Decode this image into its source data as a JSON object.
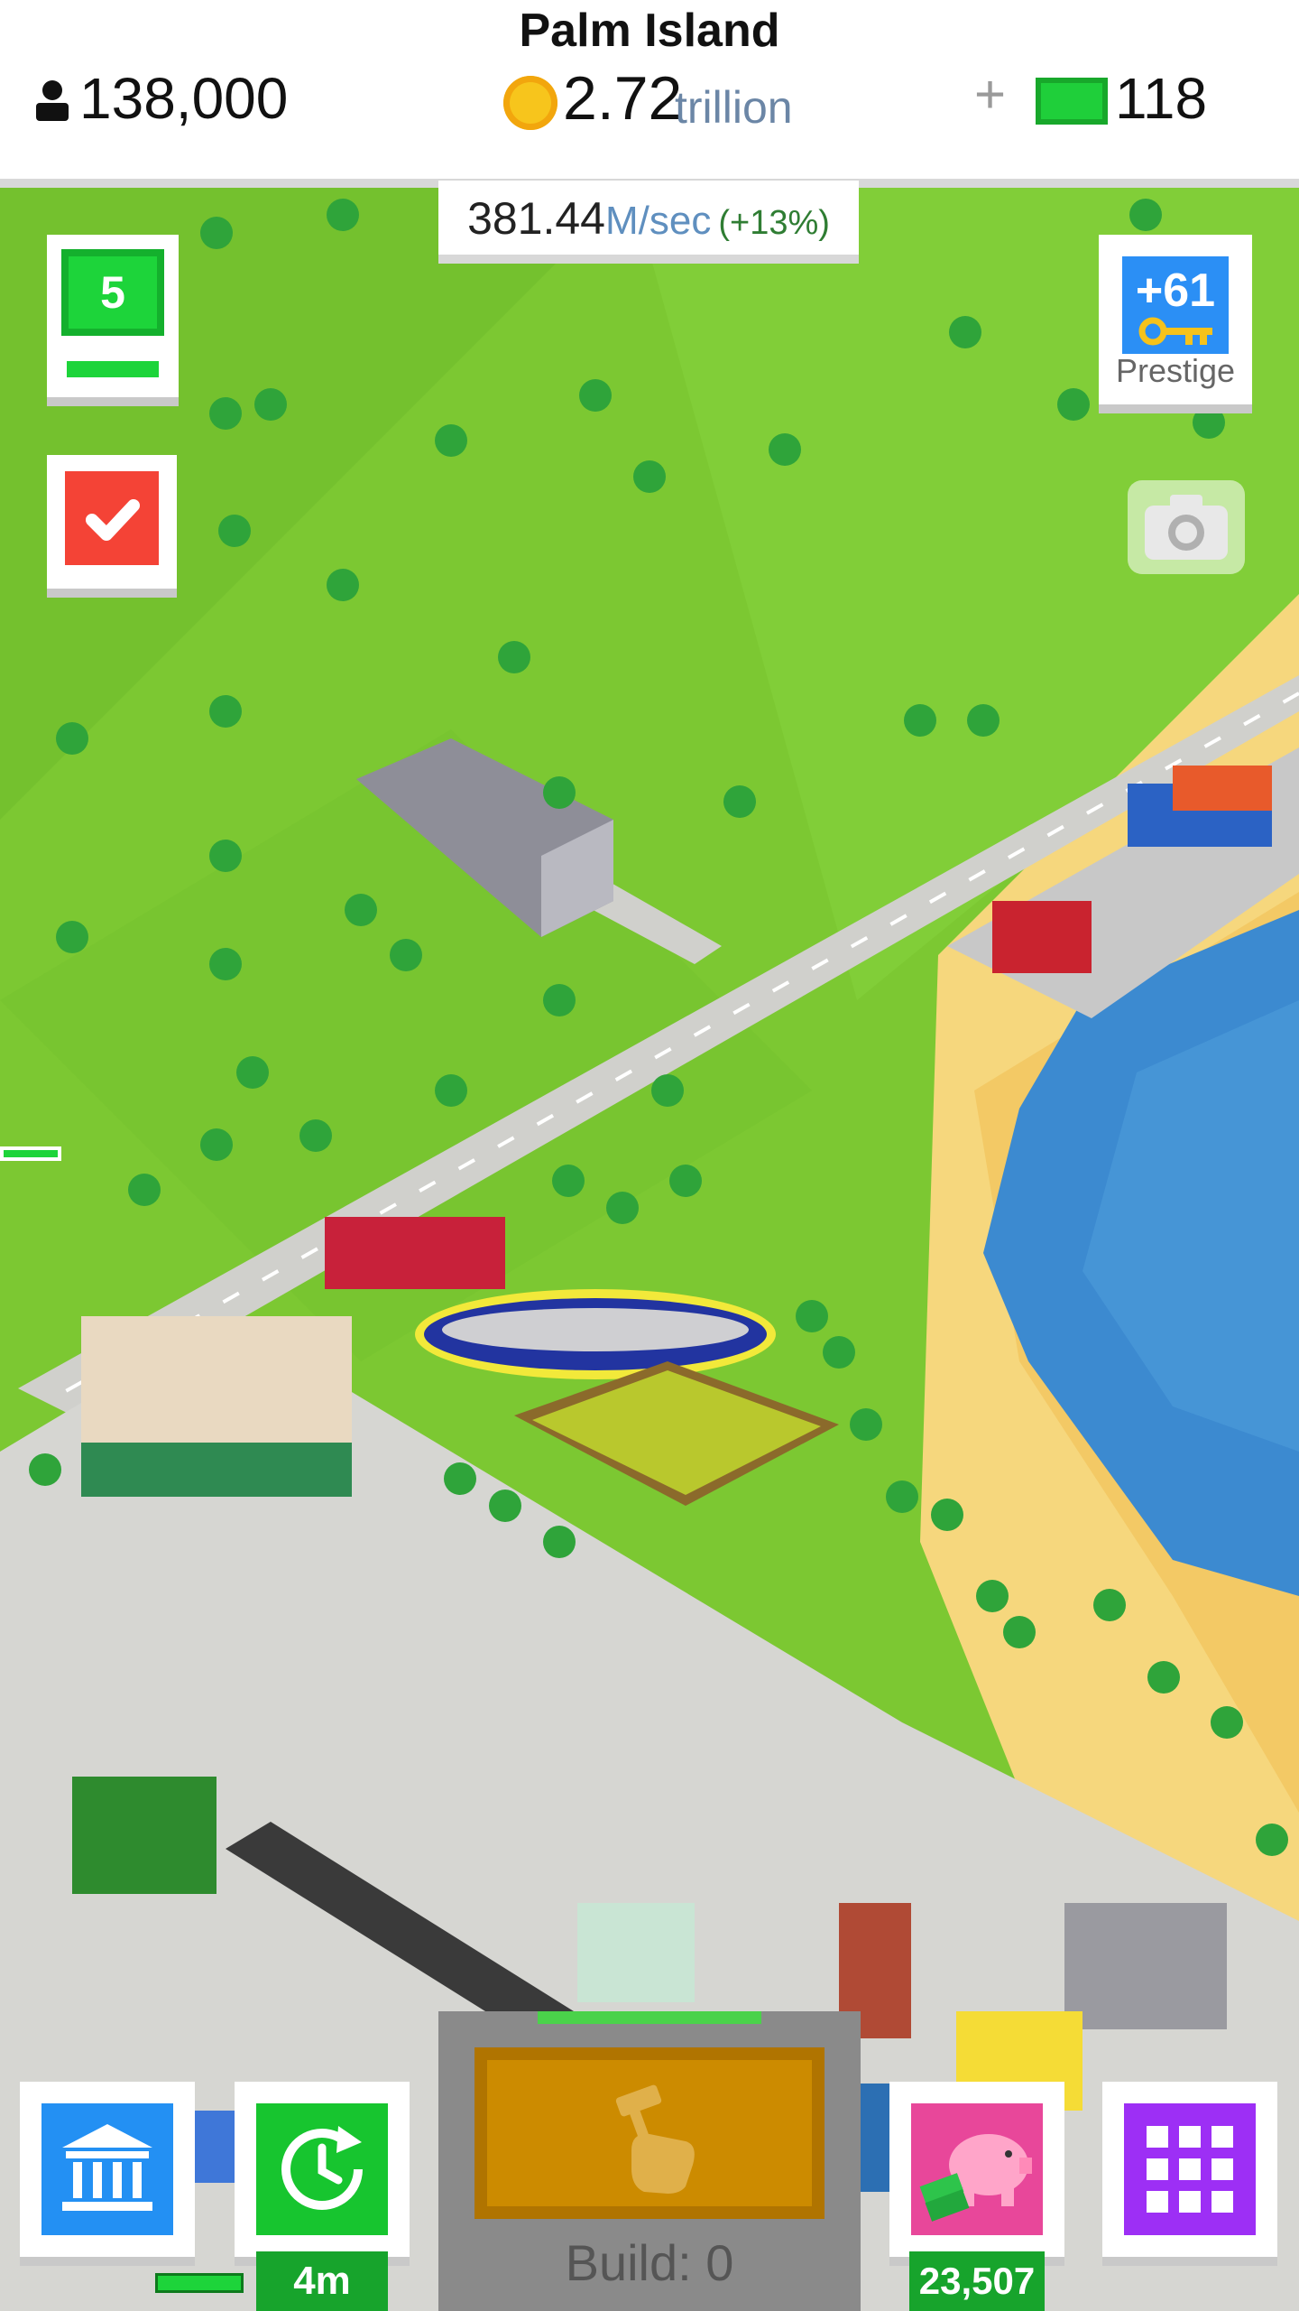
{
  "header": {
    "island_name": "Palm Island",
    "population": "138,000",
    "coins_value": "2.72",
    "coins_unit": "trillion",
    "plus_symbol": "+",
    "cash": "118"
  },
  "income": {
    "value": "381.44",
    "unit": "M/sec",
    "bonus": "(+13%)"
  },
  "left_buttons": {
    "level": "5"
  },
  "prestige": {
    "value": "+61",
    "label": "Prestige"
  },
  "bottom_bar": {
    "boost_timer": "4m",
    "build_label": "Build: 0",
    "piggy_bank_value": "23,507"
  },
  "colors": {
    "grass": "#7cc832",
    "ocean": "#3c8ad0",
    "sand": "#f6d77d",
    "level_green": "#1dd43a",
    "tasks_red": "#f44336",
    "prestige_blue": "#2b8ff5",
    "museum_blue": "#2390f3",
    "boost_green": "#17c52f",
    "build_orange": "#cc8b00",
    "piggy_pink": "#e8479a",
    "menu_purple": "#9d2ff5"
  },
  "icons": {
    "population": "person-icon",
    "coins": "coin-icon",
    "cash": "cash-icon",
    "tasks": "checkmark-icon",
    "prestige": "key-icon",
    "camera": "camera-icon",
    "museum": "museum-icon",
    "boost": "clock-refresh-icon",
    "build": "hammer-hand-icon",
    "piggy": "piggy-bank-icon",
    "menu": "grid-icon"
  }
}
